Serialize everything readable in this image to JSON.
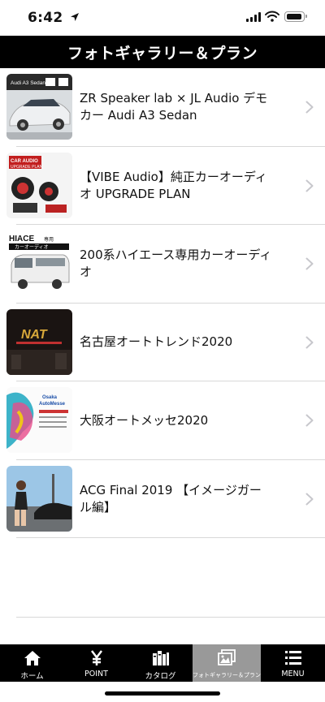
{
  "status_bar": {
    "time": "6:42"
  },
  "header": {
    "title": "フォトギャラリー＆プラン"
  },
  "gallery": [
    {
      "title": "ZR Speaker lab × JL Audio デモカー Audi A3 Sedan",
      "thumb_text": "Audi A3 Sedan"
    },
    {
      "title": "【VIBE Audio】純正カーオーディオ UPGRADE PLAN",
      "thumb_text": "CAR AUDIO UPGRADE PLAN"
    },
    {
      "title": "200系ハイエース専用カーオーディオ",
      "thumb_text": "HIACE 専用 カーオーディオ"
    },
    {
      "title": "名古屋オートトレンド2020",
      "thumb_text": "NAT"
    },
    {
      "title": "大阪オートメッセ2020",
      "thumb_text": "Osaka Auto Messe"
    },
    {
      "title": "ACG Final 2019 【イメージガール編】",
      "thumb_text": ""
    }
  ],
  "tabbar": {
    "items": [
      {
        "label": "ホーム",
        "icon": "home-icon"
      },
      {
        "label": "POINT",
        "icon": "yen-icon"
      },
      {
        "label": "カタログ",
        "icon": "books-icon"
      },
      {
        "label": "フォトギャラリー＆プラン",
        "icon": "photo-icon",
        "active": true
      },
      {
        "label": "MENU",
        "icon": "menu-icon"
      }
    ]
  },
  "colors": {
    "header_bg": "#000000",
    "tabbar_bg": "#000000",
    "tab_active_bg": "#999999",
    "chevron": "#c7c7cc"
  }
}
